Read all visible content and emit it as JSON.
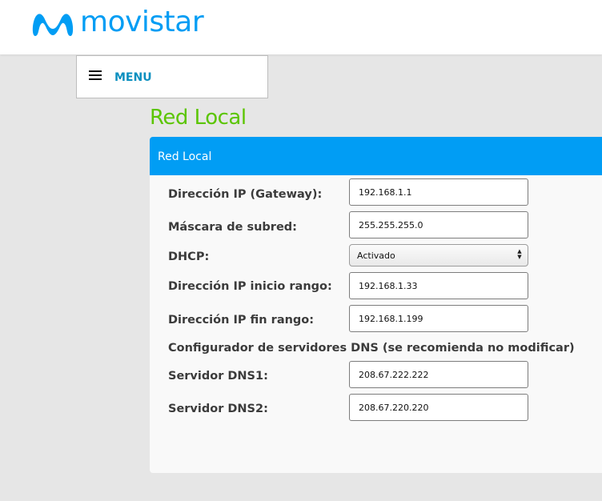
{
  "header": {
    "brand_name": "movistar",
    "logo_icon": "movistar-m-logo-icon",
    "brand_color": "#019df4"
  },
  "menu": {
    "label": "MENU",
    "icon": "hamburger-menu-icon",
    "label_color": "#0b8fbf"
  },
  "page": {
    "title": "Red Local",
    "title_color": "#5bc500"
  },
  "panel": {
    "header_title": "Red Local",
    "header_color": "#019df4",
    "fields": {
      "gateway": {
        "label": "Dirección IP (Gateway):",
        "value": "192.168.1.1"
      },
      "subnet_mask": {
        "label": "Máscara de subred:",
        "value": "255.255.255.0"
      },
      "dhcp": {
        "label": "DHCP:",
        "selected": "Activado"
      },
      "range_start": {
        "label": "Dirección IP inicio rango:",
        "value": "192.168.1.33"
      },
      "range_end": {
        "label": "Dirección IP fin rango:",
        "value": "192.168.1.199"
      }
    },
    "dns_section_title": "Configurador de servidores DNS (se recomienda no modificar)",
    "dns": {
      "dns1": {
        "label": "Servidor DNS1:",
        "value": "208.67.222.222"
      },
      "dns2": {
        "label": "Servidor DNS2:",
        "value": "208.67.220.220"
      }
    }
  }
}
